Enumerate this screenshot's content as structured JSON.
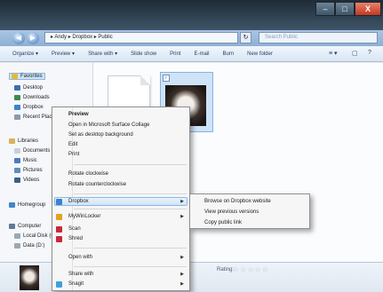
{
  "window": {
    "minimize_glyph": "–",
    "maximize_glyph": "□",
    "close_glyph": "X"
  },
  "address": {
    "path": "▸ Andy ▸ Dropbox ▸ Public",
    "refresh_glyph": "↻",
    "search_placeholder": "Search Public"
  },
  "toolbar": {
    "items": [
      "Organize ▾",
      "Preview ▾",
      "Share with ▾",
      "Slide show",
      "Print",
      "E-mail",
      "Burn",
      "New folder"
    ],
    "view_glyph": "≡ ▾",
    "pane_glyph": "▢",
    "help_glyph": "?"
  },
  "nav": {
    "items": [
      "Favorites",
      "Desktop",
      "Downloads",
      "Dropbox",
      "Recent Places",
      "Libraries",
      "Documents",
      "Music",
      "Pictures",
      "Videos",
      "Homegroup",
      "Computer",
      "Local Disk (C:)",
      "Data (D:)"
    ]
  },
  "context_menu": {
    "items": [
      "Preview",
      "Open in Microsoft Surface Collage",
      "Set as desktop background",
      "Edit",
      "Print",
      "Rotate clockwise",
      "Rotate counterclockwise",
      "Dropbox",
      "MyWinLocker",
      "Scan",
      "Shred",
      "Open with",
      "Share with",
      "Snagit"
    ]
  },
  "submenu": {
    "items": [
      "Browse on Dropbox website",
      "View previous versions",
      "Copy public link"
    ]
  },
  "details": {
    "rating_label": "Rating:",
    "rating_stars": "☆☆☆☆☆"
  },
  "colors": {
    "title_bar": "#2c3e50",
    "address_bar": "#9cbcdd",
    "highlight": "#cfe4fa",
    "close_button": "#c0391f"
  }
}
